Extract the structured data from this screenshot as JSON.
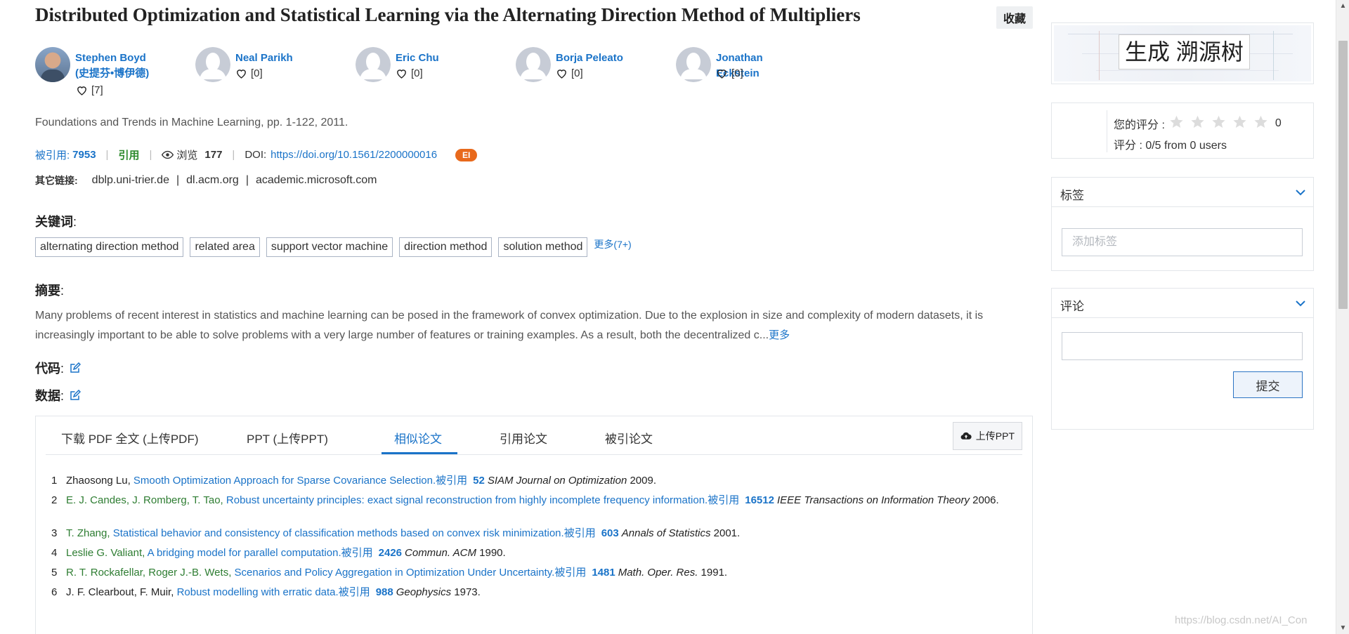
{
  "paper": {
    "title": "Distributed Optimization and Statistical Learning via the Alternating Direction Method of Multipliers",
    "collect_label": "收藏",
    "venue": "Foundations and Trends in Machine Learning, pp. 1-122, 2011.",
    "cited_label": "被引用:",
    "cited_count": "7953",
    "cite_label": "引用",
    "views_label": "浏览",
    "views_count": "177",
    "doi_label": "DOI:",
    "doi_url": "https://doi.org/10.1561/2200000016",
    "index_badge": "EI",
    "other_links_label": "其它链接:",
    "other_links": [
      "dblp.uni-trier.de",
      "dl.acm.org",
      "academic.microsoft.com"
    ],
    "link_sep": "|"
  },
  "authors": [
    {
      "name_line1": "Stephen Boyd",
      "name_line2": "(史提芬•博伊德)",
      "likes": "[7]",
      "has_photo": true
    },
    {
      "name_line1": "Neal Parikh",
      "likes": "[0]",
      "has_photo": false
    },
    {
      "name_line1": "Eric Chu",
      "likes": "[0]",
      "has_photo": false
    },
    {
      "name_line1": "Borja Peleato",
      "likes": "[0]",
      "has_photo": false
    },
    {
      "name_line1": "Jonathan Eckstein",
      "likes": "[0]",
      "has_photo": false
    }
  ],
  "keywords": {
    "label": "关键词",
    "items": [
      "alternating direction method",
      "related area",
      "support vector machine",
      "direction method",
      "solution method"
    ],
    "more_label": "更多(7+)"
  },
  "abstract": {
    "label": "摘要",
    "text": "Many problems of recent interest in statistics and machine learning can be posed in the framework of convex optimization. Due to the explosion in size and complexity of modern datasets, it is increasingly important to be able to solve problems with a very large number of features or training examples. As a result, both the decentralized c...",
    "more_label": "更多"
  },
  "code_label": "代码",
  "data_label": "数据",
  "colon": ":",
  "tabs": {
    "items": [
      "下载 PDF 全文 (上传PDF)",
      "PPT (上传PPT)",
      "相似论文",
      "引用论文",
      "被引论文"
    ],
    "active_index": 2,
    "upload_label": "上传PPT"
  },
  "references": [
    {
      "idx": "1",
      "authors": "Zhaosong Lu,",
      "authors_color": "black",
      "title": "Smooth Optimization Approach for Sparse Covariance Selection.",
      "cited_label": "被引用",
      "cited": "52",
      "journal": "SIAM Journal on Optimization",
      "year": "2009."
    },
    {
      "idx": "2",
      "authors": "E. J. Candes, J. Romberg, T. Tao,",
      "authors_color": "green",
      "title": "Robust uncertainty principles: exact signal reconstruction from highly incomplete frequency information.",
      "cited_label": "被引用",
      "cited": "16512",
      "journal": "IEEE Transactions on Information Theory",
      "year": "2006."
    },
    {
      "idx": "3",
      "authors": "T. Zhang,",
      "authors_color": "green",
      "title": "Statistical behavior and consistency of classification methods based on convex risk minimization.",
      "cited_label": "被引用",
      "cited": "603",
      "journal": "Annals of Statistics",
      "year": "2001."
    },
    {
      "idx": "4",
      "authors": "Leslie G. Valiant,",
      "authors_color": "green",
      "title": "A bridging model for parallel computation.",
      "cited_label": "被引用",
      "cited": "2426",
      "journal": "Commun. ACM",
      "year": "1990."
    },
    {
      "idx": "5",
      "authors": "R. T. Rockafellar, Roger J.-B. Wets,",
      "authors_color": "green",
      "title": "Scenarios and Policy Aggregation in Optimization Under Uncertainty.",
      "cited_label": "被引用",
      "cited": "1481",
      "journal": "Math. Oper. Res.",
      "year": "1991."
    },
    {
      "idx": "6",
      "authors": "J. F. Clearbout, F. Muir,",
      "authors_color": "black",
      "title": "Robust modelling with erratic data.",
      "cited_label": "被引用",
      "cited": "988",
      "journal": "Geophysics",
      "year": "1973."
    }
  ],
  "sidebar": {
    "trace_tree_label": "生成 溯源树",
    "your_rating_label": "您的评分 :",
    "your_rating_value": "0",
    "rating_summary": "评分 : 0/5 from 0 users",
    "stars_filled": 0,
    "tags_header": "标签",
    "tag_placeholder": "添加标签",
    "comments_header": "评论",
    "submit_label": "提交"
  },
  "watermark": "https://blog.csdn.net/AI_Con",
  "colors": {
    "link_blue": "#1a73c8",
    "author_green": "#2e7d32",
    "badge_orange": "#e8691c"
  }
}
